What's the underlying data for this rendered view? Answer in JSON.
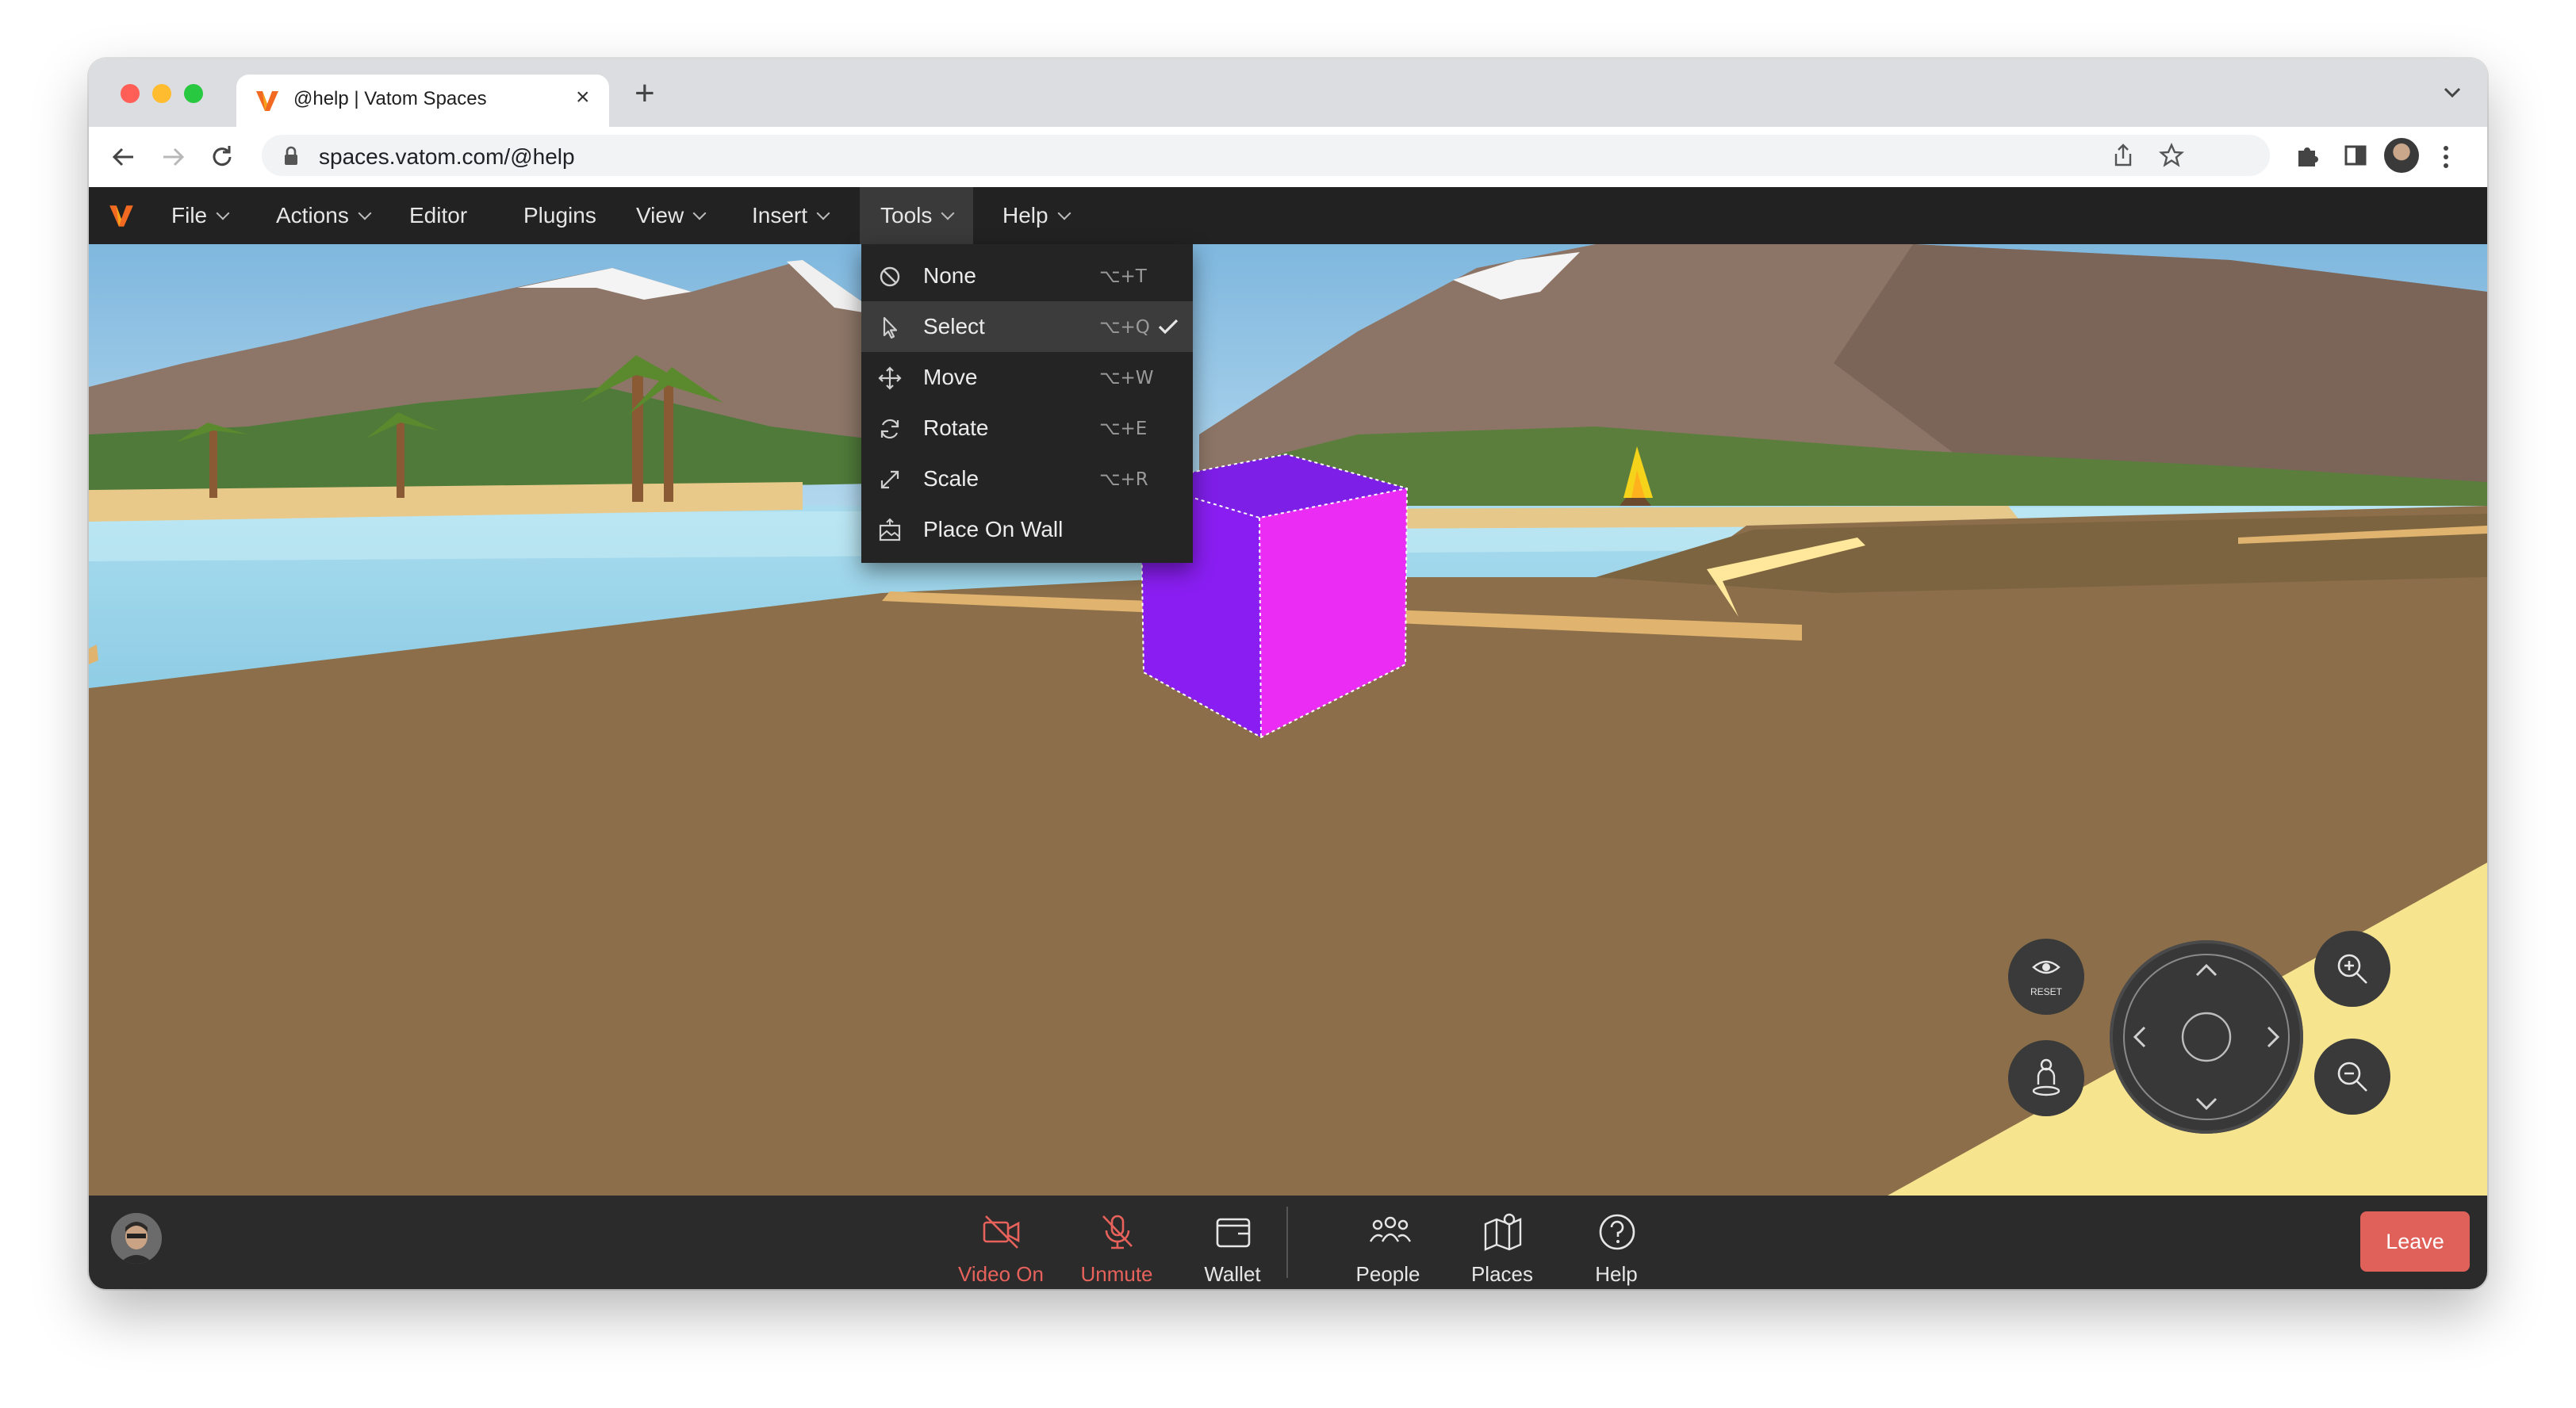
{
  "browser": {
    "tab_title": "@help | Vatom Spaces",
    "tab_close": "×",
    "new_tab": "+",
    "url": "spaces.vatom.com/@help"
  },
  "menubar": {
    "items": [
      {
        "label": "File",
        "has_dropdown": true
      },
      {
        "label": "Actions",
        "has_dropdown": true
      },
      {
        "label": "Editor",
        "has_dropdown": false
      },
      {
        "label": "Plugins",
        "has_dropdown": false
      },
      {
        "label": "View",
        "has_dropdown": true
      },
      {
        "label": "Insert",
        "has_dropdown": true
      },
      {
        "label": "Tools",
        "has_dropdown": true
      },
      {
        "label": "Help",
        "has_dropdown": true
      }
    ]
  },
  "tools_menu": {
    "items": [
      {
        "label": "None",
        "shortcut": "⌥+T",
        "icon": "none-icon",
        "checked": false
      },
      {
        "label": "Select",
        "shortcut": "⌥+Q",
        "icon": "cursor-icon",
        "checked": true
      },
      {
        "label": "Move",
        "shortcut": "⌥+W",
        "icon": "move-icon",
        "checked": false
      },
      {
        "label": "Rotate",
        "shortcut": "⌥+E",
        "icon": "rotate-icon",
        "checked": false
      },
      {
        "label": "Scale",
        "shortcut": "⌥+R",
        "icon": "scale-icon",
        "checked": false
      },
      {
        "label": "Place On Wall",
        "shortcut": "",
        "icon": "place-on-wall-icon",
        "checked": false
      }
    ]
  },
  "nav_controls": {
    "reset_label": "RESET"
  },
  "bottom_bar": {
    "buttons": [
      {
        "label": "Video On",
        "icon": "video-off-icon",
        "alert": true
      },
      {
        "label": "Unmute",
        "icon": "mic-off-icon",
        "alert": true
      },
      {
        "label": "Wallet",
        "icon": "wallet-icon",
        "alert": false
      },
      {
        "label": "People",
        "icon": "people-icon",
        "alert": false
      },
      {
        "label": "Places",
        "icon": "places-icon",
        "alert": false
      },
      {
        "label": "Help",
        "icon": "help-icon",
        "alert": false
      }
    ],
    "leave_label": "Leave"
  },
  "colors": {
    "menubar_bg": "#222222",
    "leave_button": "#e0605a",
    "alert_text": "#e8625c",
    "cube_front": "#ea2cf4",
    "cube_side": "#8a1ef2"
  }
}
